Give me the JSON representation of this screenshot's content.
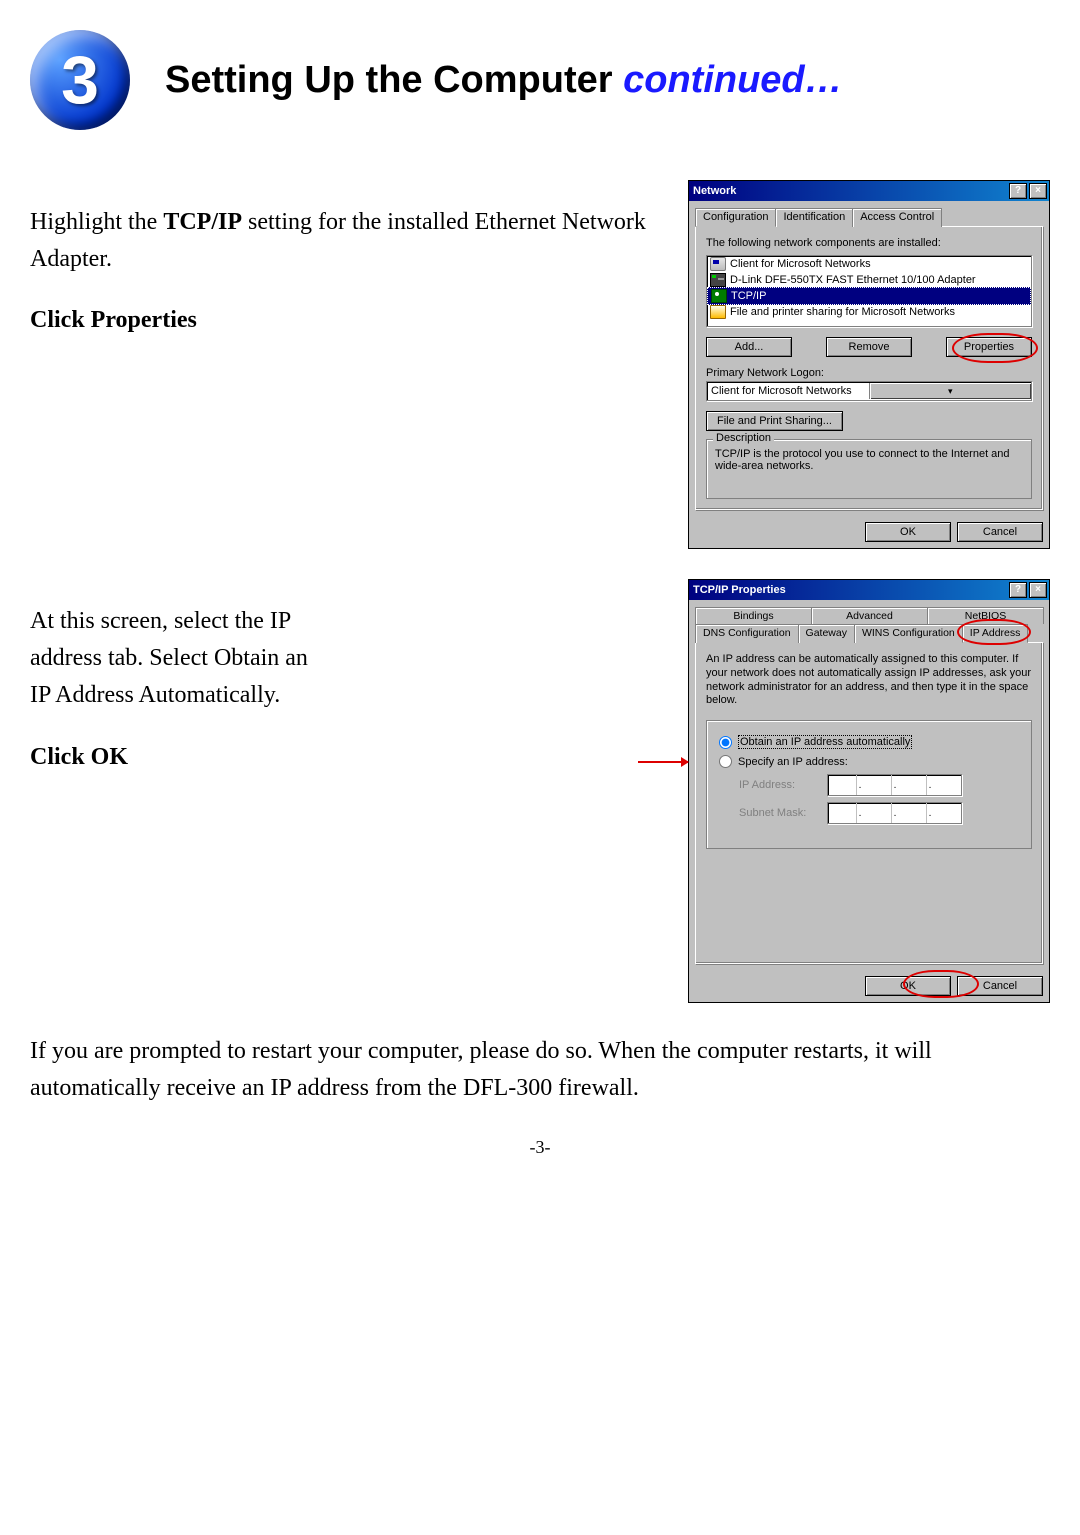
{
  "step_number": "3",
  "title_main": "Setting Up the Computer ",
  "title_cont": "continued…",
  "section1": {
    "line1_pre": "Highlight the ",
    "line1_bold": "TCP/IP",
    "line1_post": " setting for the installed Ethernet Network Adapter.",
    "line2_bold": "Click Properties"
  },
  "section2": {
    "line1": "At this screen, select the IP address tab. Select Obtain an IP Address Automatically.",
    "line2_bold": "Click OK"
  },
  "footer": "If you are prompted to restart your computer, please do so. When the computer restarts, it will automatically receive an IP address from the DFL-300 firewall.",
  "page_number": "-3-",
  "dialog1": {
    "title": "Network",
    "tabs": [
      "Configuration",
      "Identification",
      "Access Control"
    ],
    "components_label": "The following network components are installed:",
    "components": [
      "Client for Microsoft Networks",
      "D-Link DFE-550TX FAST Ethernet 10/100 Adapter",
      "TCP/IP",
      "File and printer sharing for Microsoft Networks"
    ],
    "buttons": {
      "add": "Add...",
      "remove": "Remove",
      "properties": "Properties"
    },
    "logon_label": "Primary Network Logon:",
    "logon_value": "Client for Microsoft Networks",
    "fps_button": "File and Print Sharing...",
    "desc_title": "Description",
    "desc_text": "TCP/IP is the protocol you use to connect to the Internet and wide-area networks.",
    "ok": "OK",
    "cancel": "Cancel"
  },
  "dialog2": {
    "title": "TCP/IP Properties",
    "tabs_row1": [
      "Bindings",
      "Advanced",
      "NetBIOS"
    ],
    "tabs_row2": [
      "DNS Configuration",
      "Gateway",
      "WINS Configuration",
      "IP Address"
    ],
    "desc": "An IP address can be automatically assigned to this computer. If your network does not automatically assign IP addresses, ask your network administrator for an address, and then type it in the space below.",
    "radio_auto": "Obtain an IP address automatically",
    "radio_specify": "Specify an IP address:",
    "ip_label": "IP Address:",
    "mask_label": "Subnet Mask:",
    "ok": "OK",
    "cancel": "Cancel"
  }
}
